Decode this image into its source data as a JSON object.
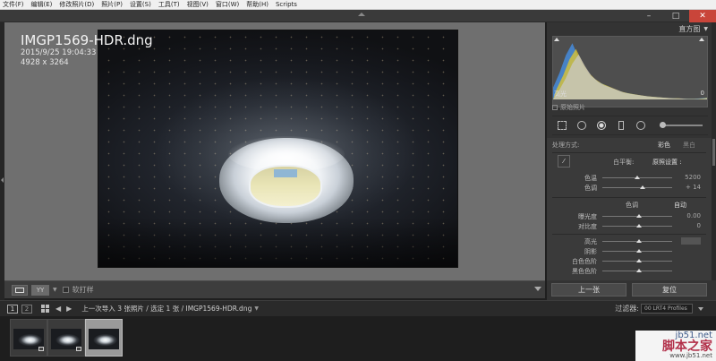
{
  "menu": [
    "文件(F)",
    "编辑(E)",
    "修改照片(D)",
    "照片(P)",
    "设置(S)",
    "工具(T)",
    "视图(V)",
    "窗口(W)",
    "帮助(H)",
    "Scripts"
  ],
  "window_controls": {
    "minimize": "–",
    "maximize": "□",
    "close": "✕"
  },
  "photo_info": {
    "filename": "IMGP1569-HDR.dng",
    "datetime": "2015/9/25 19:04:33",
    "dimensions": "4928 x 3264"
  },
  "viewer_toolbar": {
    "view_mode_label": "YY",
    "flag_label": "软打样"
  },
  "histogram": {
    "title": "直方图",
    "highlight_label": "高光",
    "highlight_value": "0",
    "original_label": "原始照片",
    "level_fractions": [
      0.2,
      0.45,
      0.75,
      0.95,
      0.7,
      0.5,
      0.38,
      0.3,
      0.25,
      0.2,
      0.15,
      0.12,
      0.1,
      0.08,
      0.06,
      0.05,
      0.04,
      0.03,
      0.02,
      0.02,
      0.01,
      0.01,
      0.01,
      0.02,
      0.03
    ]
  },
  "basic": {
    "treatment_label": "处理方式:",
    "treatment_color": "彩色",
    "treatment_bw": "黑白",
    "wb_label": "白平衡:",
    "wb_value": "原照设置 :",
    "temp_label": "色温",
    "temp_value": "5200",
    "tint_label": "色调",
    "tint_value": "+ 14",
    "tone_label": "色调",
    "auto_label": "自动",
    "exposure_label": "曝光度",
    "exposure_value": "0.00",
    "contrast_label": "对比度",
    "contrast_value": "0",
    "highlights_label": "高光",
    "shadows_label": "阴影",
    "whites_label": "白色色阶",
    "blacks_label": "黑色色阶"
  },
  "panel_buttons": {
    "previous": "上一张",
    "reset": "复位"
  },
  "filmstrip_bar": {
    "screen1": "1",
    "screen2": "2",
    "source": "上一次导入",
    "counts": "3 张照片 / 选定 1 张 /",
    "selected_file": "IMGP1569-HDR.dng",
    "filter_label": "过滤器:",
    "filter_value": "00 LRT4 Profiles"
  },
  "watermark": {
    "site": "jb51.net",
    "brand": "脚本之家",
    "url": "www.jb51.net"
  }
}
